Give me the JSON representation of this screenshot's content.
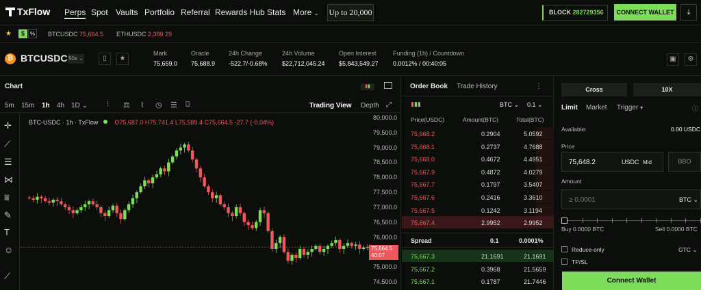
{
  "nav": {
    "logo": "TxFlow",
    "links": [
      "Perps",
      "Spot",
      "Vaults",
      "Portfolio",
      "Referral",
      "Rewards Hub",
      "Stats",
      "More"
    ],
    "promo": "Up to 20,000",
    "block_label": "BLOCK",
    "block_number": "282729356",
    "connect": "CONNECT WALLET"
  },
  "watchlist": {
    "items": [
      {
        "symbol": "BTCUSDC",
        "price": "75,664.5"
      },
      {
        "symbol": "ETHUSDC",
        "price": "2,389.29"
      }
    ]
  },
  "ticker": {
    "symbol": "BTCUSDC",
    "leverage": "50x",
    "stats": [
      {
        "label": "Mark",
        "value": "75,659.0"
      },
      {
        "label": "Oracle",
        "value": "75,688.9"
      },
      {
        "label": "24h Change",
        "value": "-522.7/-0.68%"
      },
      {
        "label": "24h Volume",
        "value": "$22,712,045.24"
      },
      {
        "label": "Open Interest",
        "value": "$5,843,549.27"
      },
      {
        "label": "Funding (1h) / Countdown",
        "value": "0.0012% / 00:40:05"
      }
    ]
  },
  "chart": {
    "title": "Chart",
    "timeframes": [
      "5m",
      "15m",
      "1h",
      "4h",
      "1D"
    ],
    "selected_timeframe": "1h",
    "trading_view": "Trading View",
    "depth": "Depth",
    "legend_symbol": "BTC-USDC · 1h · TxFlow",
    "ohlc": "O75,687.0 H75,741.4 L75,589.4 C75,664.5 -27.7 (-0.04%)",
    "price_tag": "75,664.5",
    "price_tag_time": "40:07"
  },
  "chart_data": {
    "type": "candlestick",
    "y_ticks": [
      "80,000.0",
      "79,500.0",
      "79,000.0",
      "78,500.0",
      "78,000.0",
      "77,500.0",
      "77,000.0",
      "76,500.0",
      "76,000.0",
      "75,500.0",
      "75,000.0",
      "74,500.0"
    ],
    "ylim": [
      74500,
      80000
    ],
    "closes": [
      77300,
      77250,
      77350,
      77300,
      77200,
      77150,
      77250,
      77200,
      77100,
      77000,
      76900,
      76800,
      76900,
      77000,
      77100,
      77200,
      77100,
      77000,
      76800,
      76700,
      76900,
      77050,
      76800,
      76600,
      76900,
      77100,
      77300,
      77500,
      77700,
      77900,
      77800,
      78000,
      78100,
      78300,
      78200,
      78500,
      78700,
      78900,
      79000,
      79100,
      78900,
      78600,
      78300,
      78000,
      77700,
      77500,
      77300,
      77400,
      77100,
      77000,
      76800,
      76700,
      77000,
      76800,
      76500,
      76400,
      76300,
      76500,
      76900,
      76800,
      76200,
      75600,
      75800,
      76000,
      75500,
      75200,
      75400,
      75300,
      75600,
      75400,
      75500,
      75600,
      75700,
      75500,
      75600,
      75700,
      75800,
      75900,
      75600,
      75700,
      75800,
      75700,
      75750,
      75600,
      75650,
      75664.5
    ]
  },
  "orderbook": {
    "tabs": [
      "Order Book",
      "Trade History"
    ],
    "asset": "BTC",
    "step": "0.1",
    "headers": [
      "Price(USDC)",
      "Amount(BTC)",
      "Total(BTC)"
    ],
    "asks": [
      {
        "price": "75,668.2",
        "amount": "0.2904",
        "total": "5.0592"
      },
      {
        "price": "75,668.1",
        "amount": "0.2737",
        "total": "4.7688"
      },
      {
        "price": "75,668.0",
        "amount": "0.4672",
        "total": "4.4951"
      },
      {
        "price": "75,667.9",
        "amount": "0.4872",
        "total": "4.0279"
      },
      {
        "price": "75,667.7",
        "amount": "0.1797",
        "total": "3.5407"
      },
      {
        "price": "75,667.6",
        "amount": "0.2416",
        "total": "3.3610"
      },
      {
        "price": "75,667.5",
        "amount": "0.1242",
        "total": "3.1194"
      },
      {
        "price": "75,667.4",
        "amount": "2.9952",
        "total": "2.9952"
      }
    ],
    "spread_label": "Spread",
    "spread_value": "0.1",
    "spread_pct": "0.0001%",
    "bids": [
      {
        "price": "75,667.3",
        "amount": "21.1691",
        "total": "21.1691"
      },
      {
        "price": "75,667.2",
        "amount": "0.3968",
        "total": "21.5659"
      },
      {
        "price": "75,667.1",
        "amount": "0.1787",
        "total": "21.7446"
      }
    ]
  },
  "form": {
    "margin_mode": "Cross",
    "leverage": "10X",
    "tabs": [
      "Limit",
      "Market",
      "Trigger"
    ],
    "available_label": "Available:",
    "available_value": "0.00 USDC",
    "price_label": "Price",
    "price_value": "75,648.2",
    "price_unit": "USDC",
    "mid": "Mid",
    "bbo": "BBO",
    "amount_label": "Amount",
    "amount_placeholder": "≥ 0.0001",
    "amount_unit": "BTC",
    "buy_label": "Buy 0.0000 BTC",
    "sell_label": "Sell 0.0000 BTC",
    "reduce_only": "Reduce-only",
    "tif": "GTC",
    "tpsl": "TP/SL",
    "connect": "Connect Wallet"
  },
  "colors": {
    "accent": "#7ddc5a",
    "down": "#f0575c",
    "bg": "#0c0e0b"
  }
}
